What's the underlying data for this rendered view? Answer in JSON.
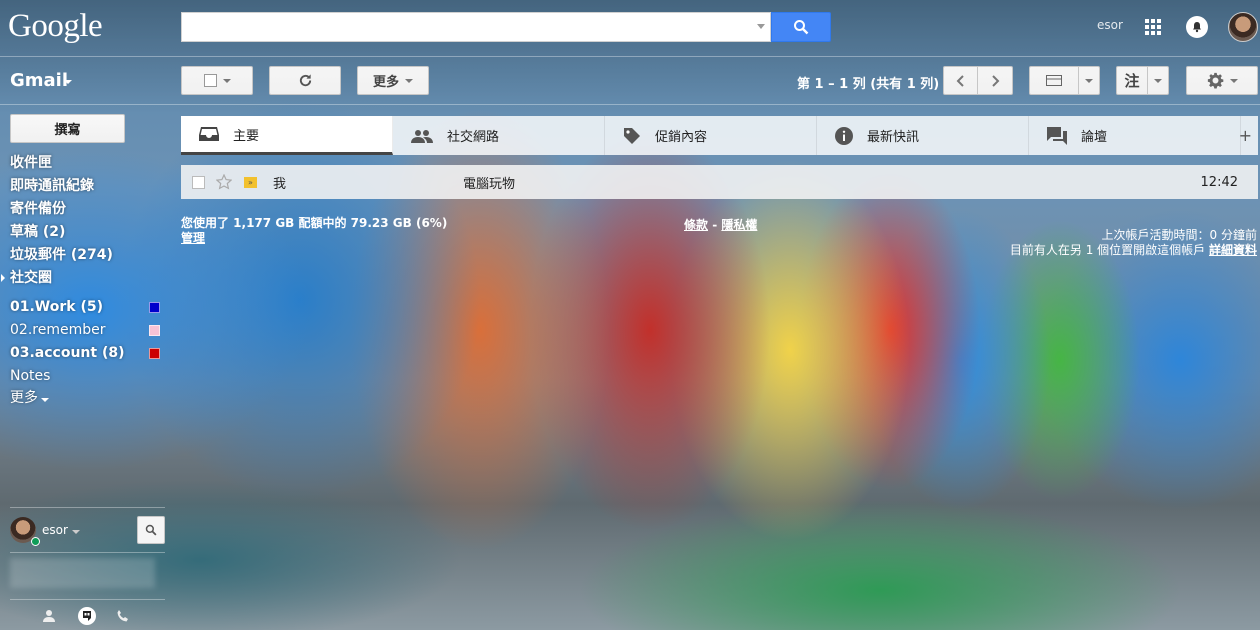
{
  "header": {
    "logo": "Google",
    "search_value": "",
    "user_name": "esor"
  },
  "toolbar": {
    "app_title": "Gmail",
    "more_label": "更多",
    "page_info": "第 1 – 1 列 (共有 1 列)",
    "input_tools_label": "注"
  },
  "sidebar": {
    "compose_label": "撰寫",
    "items": [
      {
        "label": "收件匣"
      },
      {
        "label": "即時通訊紀錄"
      },
      {
        "label": "寄件備份"
      },
      {
        "label": "草稿 (2)"
      },
      {
        "label": "垃圾郵件 (274)"
      },
      {
        "label": "社交圈"
      },
      {
        "label": "01.Work (5)",
        "color": "#0000cc"
      },
      {
        "label": "02.remember",
        "color": "#f7c3d6"
      },
      {
        "label": "03.account (8)",
        "color": "#cc0000"
      },
      {
        "label": "Notes"
      },
      {
        "label": "更多"
      }
    ]
  },
  "tabs": [
    {
      "label": "主要",
      "icon": "inbox-icon"
    },
    {
      "label": "社交網路",
      "icon": "people-icon"
    },
    {
      "label": "促銷內容",
      "icon": "tag-icon"
    },
    {
      "label": "最新快訊",
      "icon": "info-icon"
    },
    {
      "label": "論壇",
      "icon": "forum-icon"
    }
  ],
  "messages": [
    {
      "sender": "我",
      "subject": "電腦玩物",
      "time": "12:42"
    }
  ],
  "footer": {
    "storage": "您使用了 1,177 GB 配額中的 79.23 GB (6%)",
    "manage": "管理",
    "terms": "條款",
    "separator": " - ",
    "privacy": "隱私權",
    "last_activity": "上次帳戶活動時間：0 分鐘前",
    "open_location": "目前有人在另 1 個位置開啟這個帳戶",
    "details": "詳細資料"
  },
  "chat": {
    "user_name": "esor"
  },
  "colors": {
    "search_button": "#4486f5",
    "online": "#0f9d58"
  }
}
